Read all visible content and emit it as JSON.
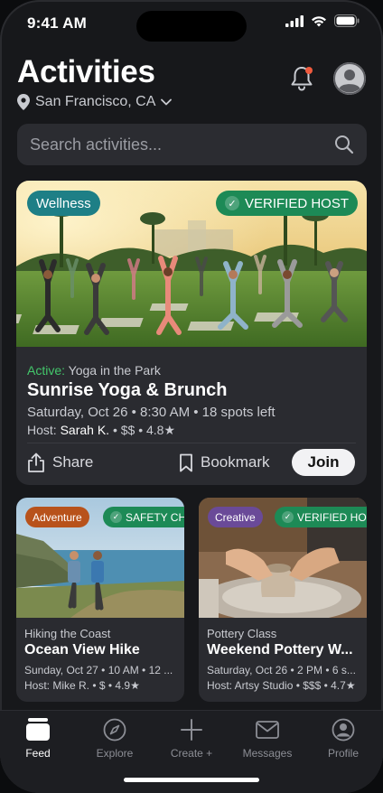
{
  "status_bar": {
    "time": "9:41 AM"
  },
  "header": {
    "title": "Activities",
    "location": "San Francisco, CA"
  },
  "search": {
    "placeholder": "Search activities..."
  },
  "featured": {
    "category_pill": "Wellness",
    "verified_pill": "VERIFIED HOST",
    "status_label": "Active:",
    "subtitle": "Yoga in the Park",
    "title": "Sunrise Yoga & Brunch",
    "when": "Saturday, Oct 26 • 8:30 AM • 18 spots left",
    "host_prefix": "Host:",
    "host_name": "Sarah K.",
    "host_meta": "• $$ • 4.8★",
    "share_label": "Share",
    "bookmark_label": "Bookmark",
    "join_label": "Join"
  },
  "cards": [
    {
      "category_pill": "Adventure",
      "badge": "SAFETY CHE",
      "subtitle": "Hiking the Coast",
      "title": "Ocean View Hike",
      "when": "Sunday, Oct 27 • 10 AM • 12 ...",
      "host": "Host: Mike R. • $ • 4.9★"
    },
    {
      "category_pill": "Creative",
      "badge": "VERIFIED HOST",
      "subtitle": "Pottery Class",
      "title": "Weekend Pottery W...",
      "when": "Saturday, Oct 26 • 2 PM • 6 s...",
      "host": "Host: Artsy Studio • $$$ • 4.7★"
    }
  ],
  "tabs": [
    {
      "label": "Feed",
      "icon": "feed-icon",
      "active": true
    },
    {
      "label": "Explore",
      "icon": "compass-icon",
      "active": false
    },
    {
      "label": "Create +",
      "icon": "plus-icon",
      "active": false
    },
    {
      "label": "Messages",
      "icon": "mail-icon",
      "active": false
    },
    {
      "label": "Profile",
      "icon": "profile-icon",
      "active": false
    }
  ],
  "colors": {
    "background": "#17181b",
    "card": "#2a2b30",
    "wellness": "#1e7f86",
    "verified": "#1d8a56",
    "adventure": "#b8521b",
    "creative": "#6a4a98",
    "active_green": "#43c76b",
    "notification": "#ef5a3e"
  }
}
